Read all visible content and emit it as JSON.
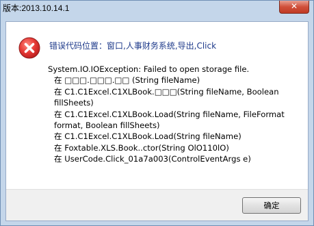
{
  "window": {
    "title": "版本:2013.10.14.1",
    "close_glyph": "✕"
  },
  "dialog": {
    "icon": "error-icon",
    "heading": "错误代码位置：窗口,人事财务系统,导出,Click",
    "trace_lines": [
      {
        "text": "System.IO.IOException: Failed to open storage file.",
        "indent": false
      },
      {
        "text": "在 □□□.□□□.□□ (String fileName)",
        "indent": true
      },
      {
        "text": "在 C1.C1Excel.C1XLBook.□□□(String fileName, Boolean fillSheets)",
        "indent": true
      },
      {
        "text": "在 C1.C1Excel.C1XLBook.Load(String fileName, FileFormat format, Boolean fillSheets)",
        "indent": true
      },
      {
        "text": "在 C1.C1Excel.C1XLBook.Load(String fileName)",
        "indent": true
      },
      {
        "text": "在 Foxtable.XLS.Book..ctor(String OlO110lO)",
        "indent": true
      },
      {
        "text": "在 UserCode.Click_01a7a003(ControlEventArgs e)",
        "indent": true
      }
    ],
    "ok_label": "确定"
  },
  "colors": {
    "frame": "#c4d6ea",
    "heading_text": "#1e3a8a",
    "close_button": "#d0503a",
    "error_icon": "#d32f2f"
  }
}
